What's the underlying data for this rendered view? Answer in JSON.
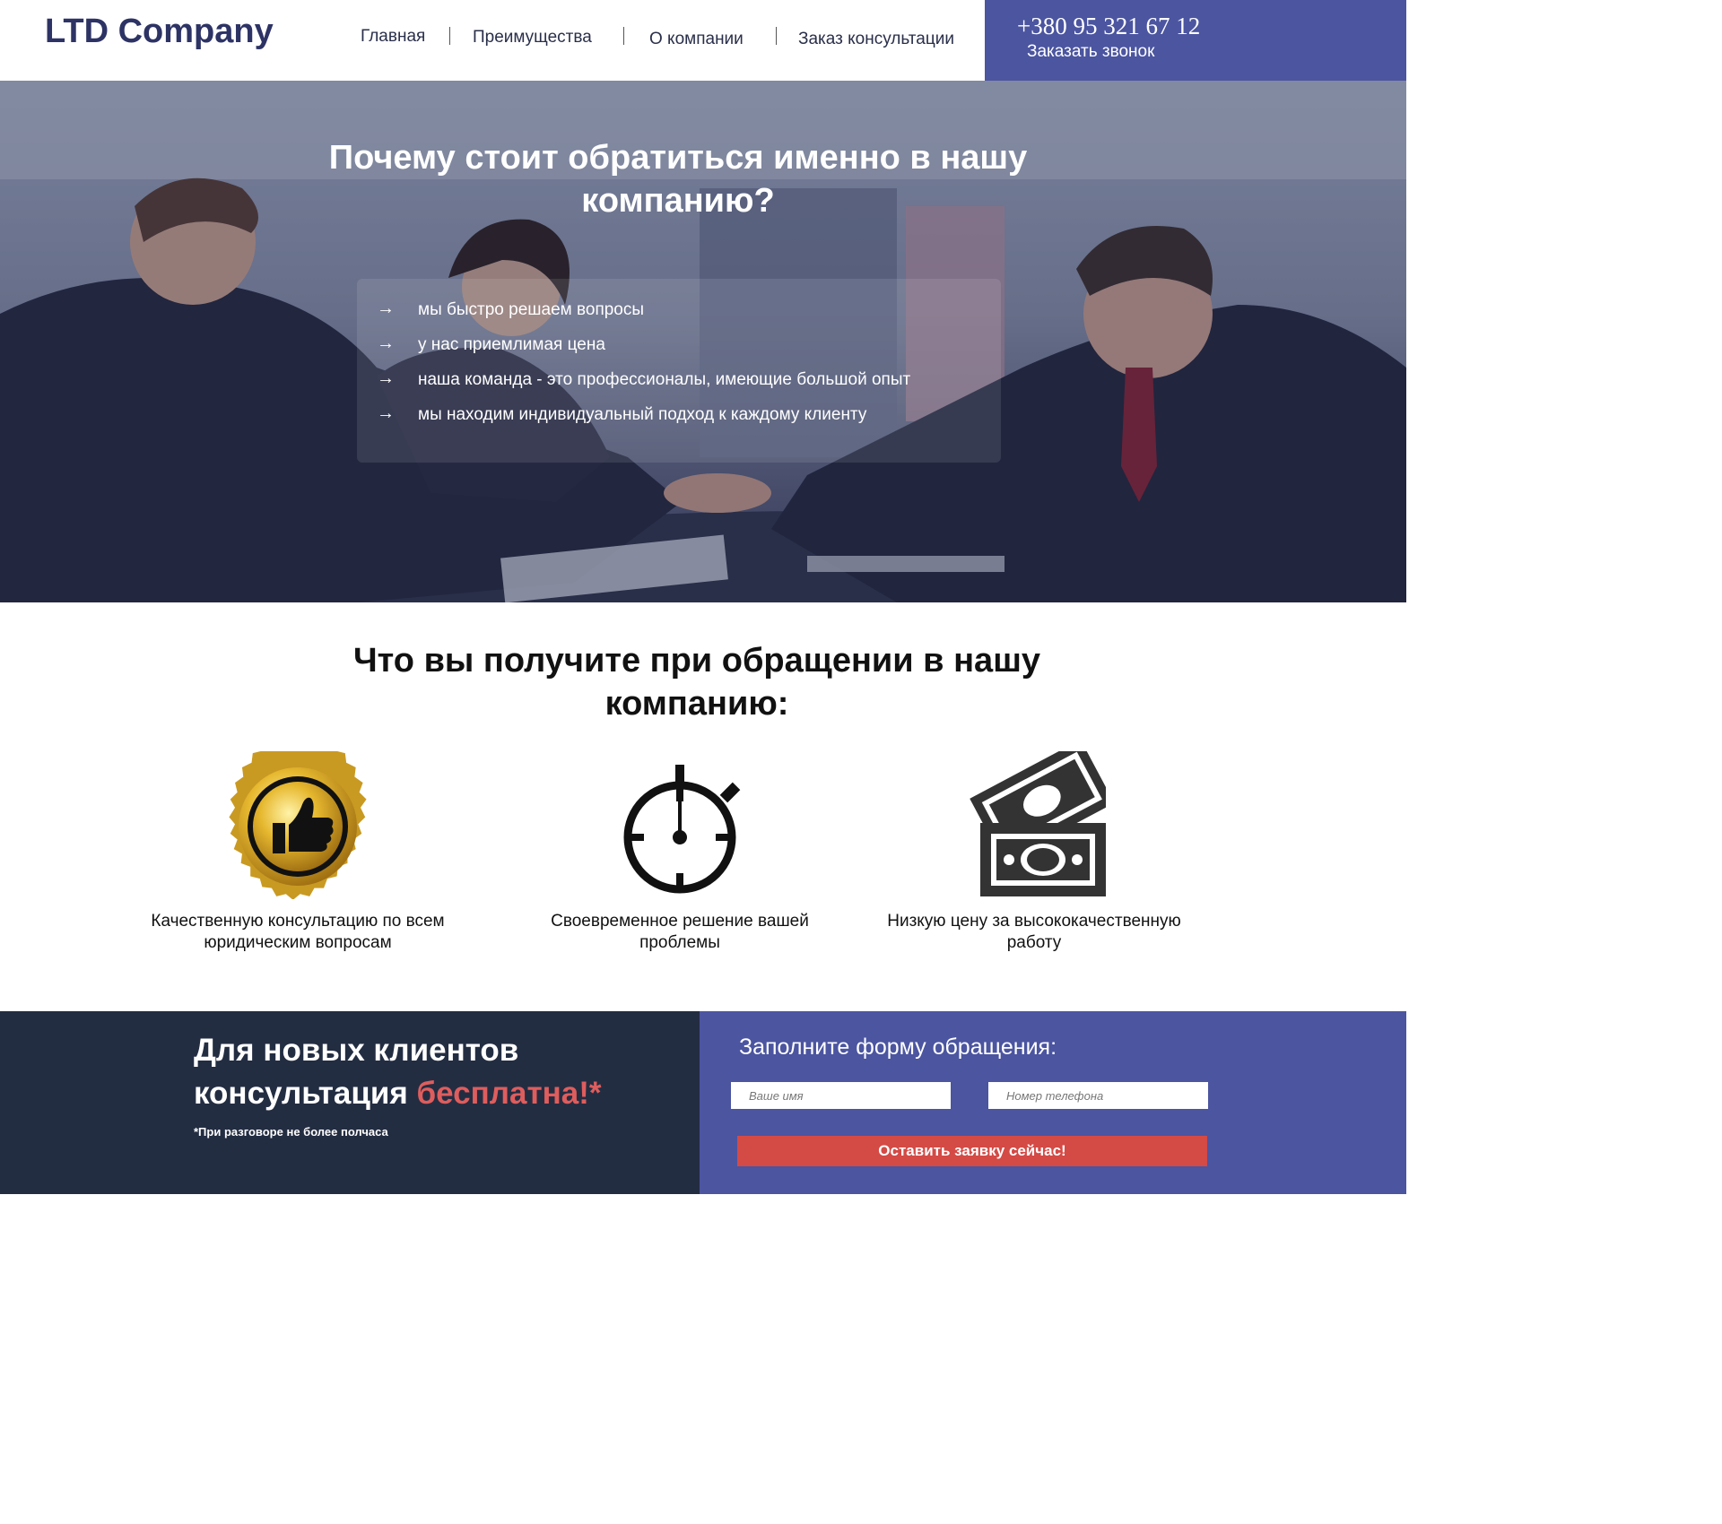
{
  "header": {
    "logo": "LTD Company",
    "nav": [
      "Главная",
      "Преимущества",
      "О компании",
      "Заказ консультации"
    ],
    "phone": "+380 95 321 67 12",
    "callback": "Заказать звонок"
  },
  "hero": {
    "title": "Почему стоит обратиться именно в нашу компанию?",
    "items": [
      "мы быстро решаем вопросы",
      "у нас приемлимая цена",
      "наша команда - это профессионалы, имеющие большой опыт",
      "мы находим индивидуальный подход к каждому клиенту"
    ],
    "arrow": "→"
  },
  "benefits": {
    "title": "Что вы получите при обращении в нашу компанию:",
    "items": [
      {
        "icon": "gold-seal-thumbs-up-icon",
        "text": "Качественную консультацию по всем юридическим вопросам"
      },
      {
        "icon": "stopwatch-icon",
        "text": "Своевременное решение вашей проблемы"
      },
      {
        "icon": "money-bills-icon",
        "text": "Низкую цену за высококачественную работу"
      }
    ]
  },
  "promo": {
    "line1": "Для новых клиентов",
    "line2_prefix": "консультация ",
    "line2_accent": "бесплатна!*",
    "note": "*При разговоре не более полчаса"
  },
  "form": {
    "title": "Заполните форму обращения:",
    "name_placeholder": "Ваше имя",
    "phone_placeholder": "Номер телефона",
    "submit": "Оставить заявку сейчас!"
  },
  "colors": {
    "brand": "#4b55a0",
    "dark": "#232d42",
    "accent": "#de5d5d",
    "button": "#d44a45",
    "logo": "#2d3364"
  }
}
